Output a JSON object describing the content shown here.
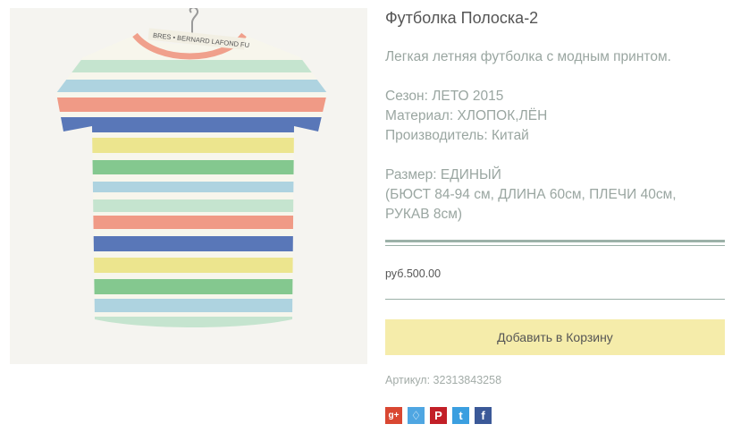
{
  "product": {
    "title": "Футболка Полоска-2",
    "description": "Легкая летняя футболка с модным принтом.",
    "season": "Сезон: ЛЕТО 2015",
    "material": "Материал: ХЛОПОК,ЛЁН",
    "manufacturer": "Производитель: Китай",
    "size": "Размер: ЕДИНЫЙ",
    "measurements_1": "(БЮСТ 84-94 см, ДЛИНА 60см, ПЛЕЧИ 40см,",
    "measurements_2": "РУКАВ 8см)",
    "price": "руб.500.00",
    "add_to_cart_label": "Добавить в Корзину",
    "sku": "Артикул: 32313843258",
    "tag_text": "BRES • BERNARD LAFOND FU"
  },
  "share": {
    "gplus": "g+",
    "vk": "♢",
    "pinterest": "P",
    "twitter": "t",
    "facebook": "f"
  },
  "colors": {
    "accent_button": "#f5ecaa",
    "divider": "#9cb1a8",
    "stripes": [
      "#aed3e0",
      "#f09a86",
      "#5977b8",
      "#ece58e",
      "#84c88f",
      "#c5e4cf"
    ]
  }
}
